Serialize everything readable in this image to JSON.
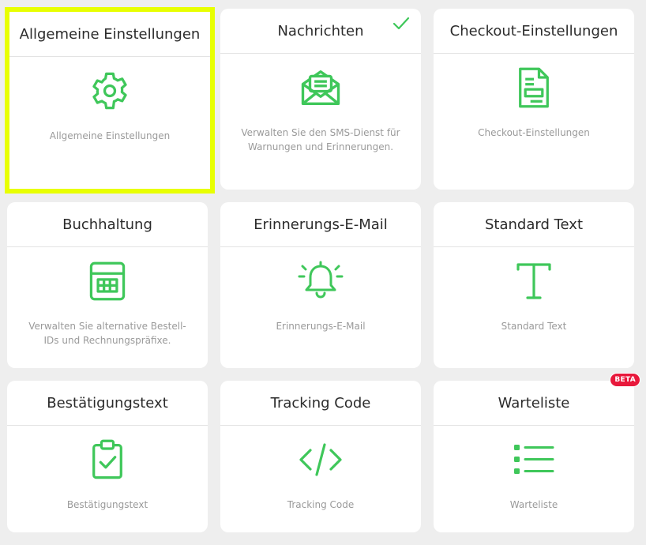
{
  "colors": {
    "accent": "#3fc75a",
    "selection": "#e8ff00",
    "badge": "#e8193c"
  },
  "cards": [
    {
      "title": "Allgemeine Einstellungen",
      "description": "Allgemeine Einstellungen",
      "icon": "gear-icon",
      "selected": true
    },
    {
      "title": "Nachrichten",
      "description": "Verwalten Sie den SMS-Dienst für Warnungen und Erinnerungen.",
      "icon": "envelope-open-icon",
      "status": "check-icon"
    },
    {
      "title": "Checkout-Einstellungen",
      "description": "Checkout-Einstellungen",
      "icon": "document-icon"
    },
    {
      "title": "Buchhaltung",
      "description": "Verwalten Sie alternative Bestell-IDs und Rechnungspräfixe.",
      "icon": "calculator-icon"
    },
    {
      "title": "Erinnerungs-E-Mail",
      "description": "Erinnerungs-E-Mail",
      "icon": "bell-icon"
    },
    {
      "title": "Standard Text",
      "description": "Standard Text",
      "icon": "text-t-icon"
    },
    {
      "title": "Bestätigungstext",
      "description": "Bestätigungstext",
      "icon": "clipboard-check-icon"
    },
    {
      "title": "Tracking Code",
      "description": "Tracking Code",
      "icon": "code-icon"
    },
    {
      "title": "Warteliste",
      "description": "Warteliste",
      "icon": "list-icon",
      "badge": "BETA"
    }
  ]
}
